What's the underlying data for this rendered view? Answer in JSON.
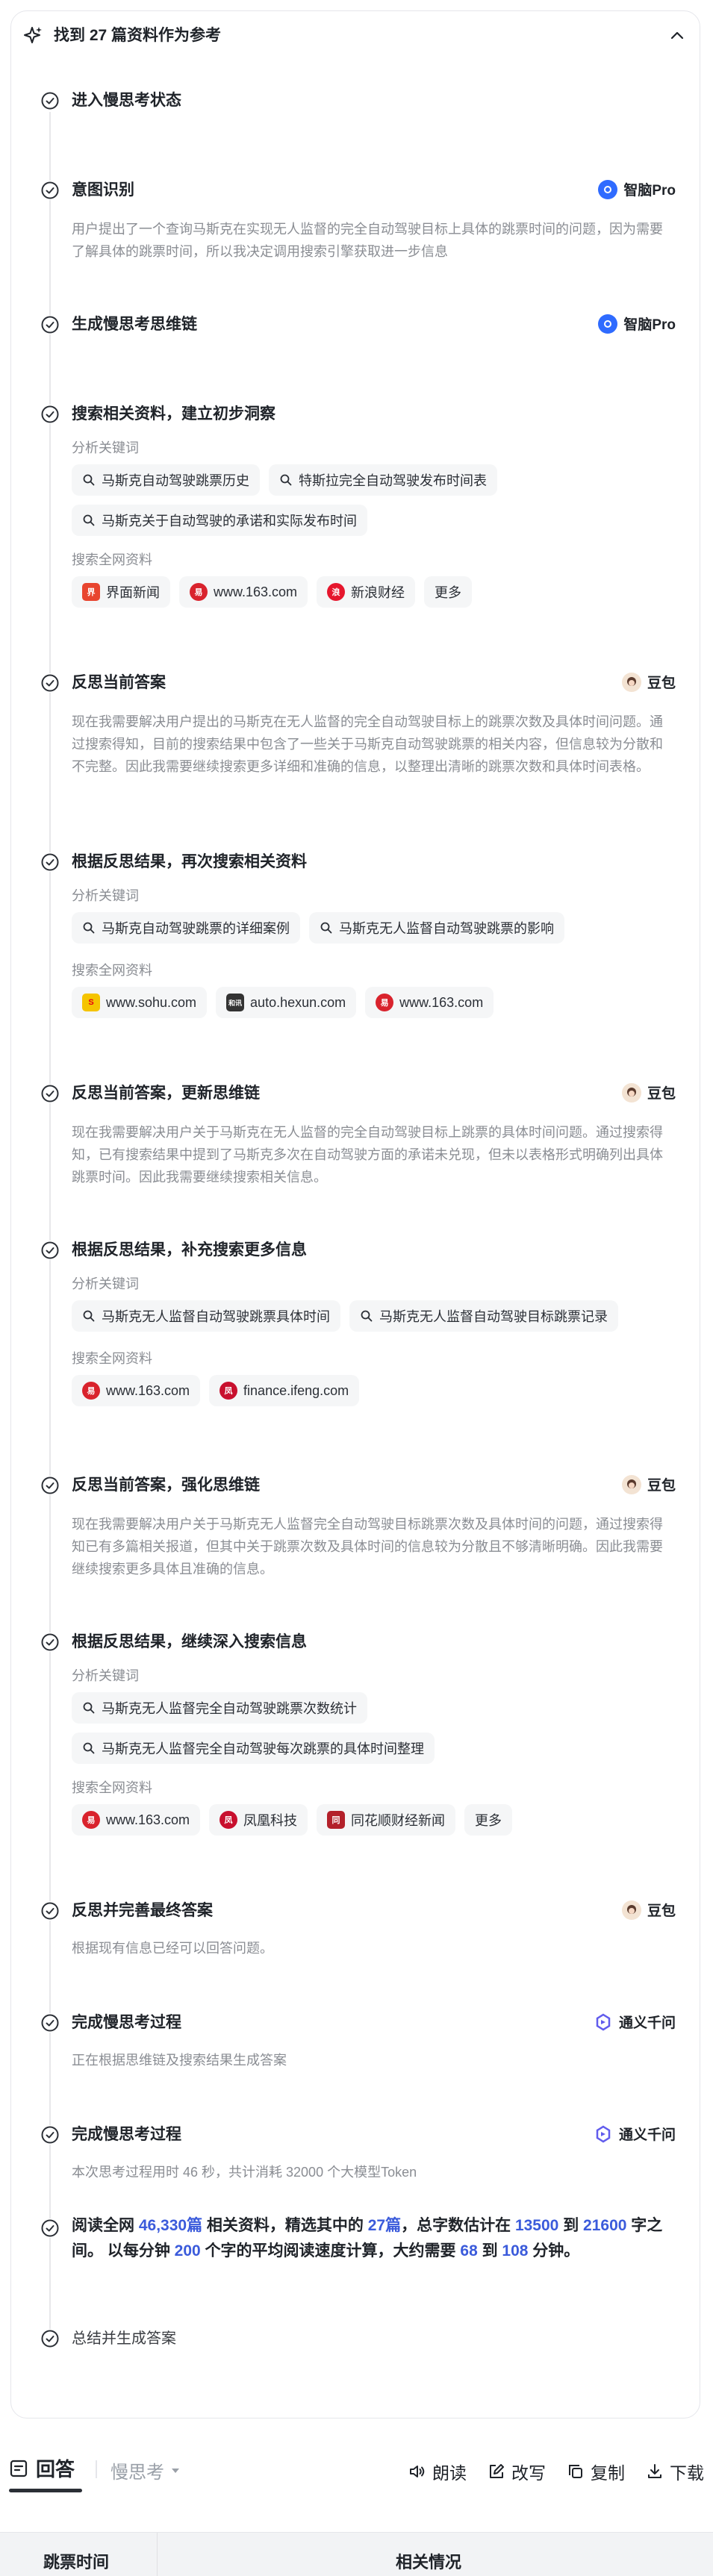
{
  "header": {
    "title": "找到 27 篇资料作为参考"
  },
  "labels": {
    "keywords": "分析关键词",
    "sources": "搜索全网资料",
    "more": "更多"
  },
  "models": {
    "zhipu": "智脑Pro",
    "doubao": "豆包",
    "tongyi": "通义千问"
  },
  "steps": [
    {
      "title": "进入慢思考状态"
    },
    {
      "title": "意图识别",
      "desc": "用户提出了一个查询马斯克在实现无人监督的完全自动驾驶目标上具体的跳票时间的问题，因为需要了解具体的跳票时间，所以我决定调用搜索引擎获取进一步信息"
    },
    {
      "title": "生成慢思考思维链"
    },
    {
      "title": "搜索相关资料，建立初步洞察",
      "keywords": [
        "马斯克自动驾驶跳票历史",
        "特斯拉完全自动驾驶发布时间表",
        "马斯克关于自动驾驶的承诺和实际发布时间"
      ],
      "sources": [
        "界面新闻",
        "www.163.com",
        "新浪财经"
      ]
    },
    {
      "title": "反思当前答案",
      "desc": "现在我需要解决用户提出的马斯克在无人监督的完全自动驾驶目标上的跳票次数及具体时间问题。通过搜索得知，目前的搜索结果中包含了一些关于马斯克自动驾驶跳票的相关内容，但信息较为分散和不完整。因此我需要继续搜索更多详细和准确的信息，以整理出清晰的跳票次数和具体时间表格。"
    },
    {
      "title": "根据反思结果，再次搜索相关资料",
      "keywords": [
        "马斯克自动驾驶跳票的详细案例",
        "马斯克无人监督自动驾驶跳票的影响"
      ],
      "sources": [
        "www.sohu.com",
        "auto.hexun.com",
        "www.163.com"
      ]
    },
    {
      "title": "反思当前答案，更新思维链",
      "desc": "现在我需要解决用户关于马斯克在无人监督的完全自动驾驶目标上跳票的具体时间问题。通过搜索得知，已有搜索结果中提到了马斯克多次在自动驾驶方面的承诺未兑现，但未以表格形式明确列出具体跳票时间。因此我需要继续搜索相关信息。"
    },
    {
      "title": "根据反思结果，补充搜索更多信息",
      "keywords": [
        "马斯克无人监督自动驾驶跳票具体时间",
        "马斯克无人监督自动驾驶目标跳票记录"
      ],
      "sources": [
        "www.163.com",
        "finance.ifeng.com"
      ]
    },
    {
      "title": "反思当前答案，强化思维链",
      "desc": "现在我需要解决用户关于马斯克无人监督完全自动驾驶目标跳票次数及具体时间的问题，通过搜索得知已有多篇相关报道，但其中关于跳票次数及具体时间的信息较为分散且不够清晰明确。因此我需要继续搜索更多具体且准确的信息。"
    },
    {
      "title": "根据反思结果，继续深入搜索信息",
      "keywords": [
        "马斯克无人监督完全自动驾驶跳票次数统计",
        "马斯克无人监督完全自动驾驶每次跳票的具体时间整理"
      ],
      "sources": [
        "www.163.com",
        "凤凰科技",
        "同花顺财经新闻"
      ]
    },
    {
      "title": "反思并完善最终答案",
      "desc": "根据现有信息已经可以回答问题。"
    },
    {
      "title": "完成慢思考过程",
      "desc": "正在根据思维链及搜索结果生成答案"
    },
    {
      "title": "完成慢思考过程",
      "desc": "本次思考过程用时 46 秒，共计消耗 32000 个大模型Token"
    },
    {
      "title": "总结并生成答案"
    }
  ],
  "summary": {
    "p1": "阅读全网 ",
    "n1": "46,330篇",
    "p2": " 相关资料，精选其中的 ",
    "n2": "27篇",
    "p3": "，总字数估计在 ",
    "n3": "13500",
    "p4": " 到 ",
    "n4": "21600",
    "p5": " 字之间。 以每分钟 ",
    "n5": "200",
    "p6": " 个字的平均阅读速度计算，大约需要 ",
    "n6": "68",
    "p7": " 到 ",
    "n7": "108",
    "p8": " 分钟。"
  },
  "bottom": {
    "answer_tab": "回答",
    "slow_tab": "慢思考",
    "actions": {
      "read": "朗读",
      "rewrite": "改写",
      "copy": "复制",
      "download": "下载"
    }
  },
  "table": {
    "headers": [
      "跳票时间",
      "相关情况"
    ]
  },
  "colors": {
    "accent": "#3b5bdb",
    "muted": "#8a8d93",
    "chip_bg": "#f5f6f7"
  }
}
